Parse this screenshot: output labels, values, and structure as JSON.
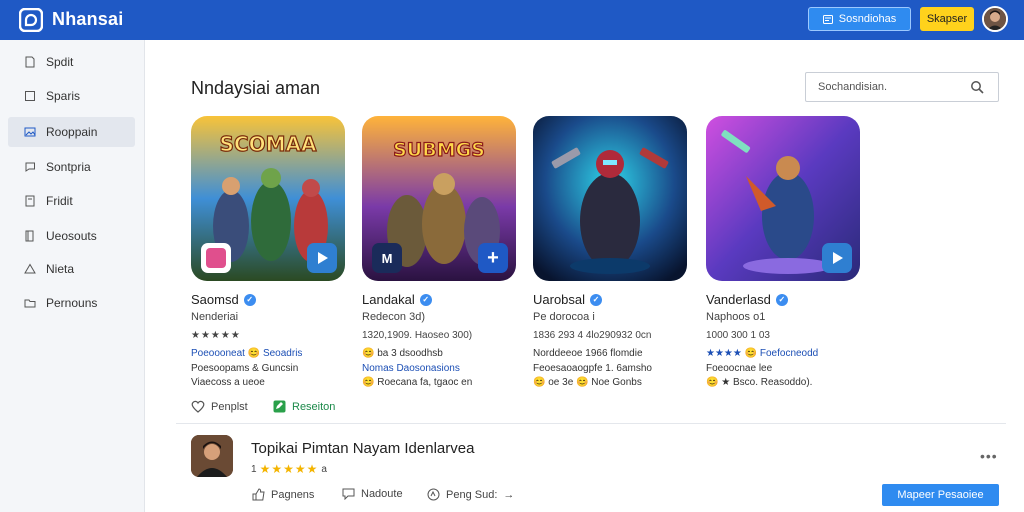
{
  "app": {
    "name": "Nhansai",
    "header_button_label": "Sosndiohas",
    "header_yellow_label": "Skapser"
  },
  "sidebar": {
    "items": [
      {
        "label": "Spdit",
        "icon": "document-icon"
      },
      {
        "label": "Sparis",
        "icon": "square-icon"
      },
      {
        "label": "Rooppain",
        "icon": "image-icon",
        "active": true
      },
      {
        "label": "Sontpria",
        "icon": "chat-icon"
      },
      {
        "label": "Fridit",
        "icon": "file-icon"
      },
      {
        "label": "Ueosouts",
        "icon": "book-icon"
      },
      {
        "label": "Nieta",
        "icon": "triangle-icon"
      },
      {
        "label": "Pernouns",
        "icon": "folder-icon"
      }
    ]
  },
  "main": {
    "title": "Nndaysiai aman",
    "search_placeholder": "Sochandisian."
  },
  "cards": [
    {
      "art_title": "SCOMAA",
      "name": "Saomsd",
      "sub": "Nenderiai",
      "meta": "★★★★★",
      "l1": "Poeoooneat 😊 Seoadris",
      "l2": "Poesoopams & Guncsin",
      "l3": "Viaecoss a ueoe",
      "colors": [
        "#f6b32b",
        "#2f7fd1"
      ],
      "badge": "#e04f8d"
    },
    {
      "art_title": "SUBMGS",
      "name": "Landakal",
      "sub": "Redecon 3d)",
      "meta": "1320,1909. Haoseo 300)",
      "l1": "😊 ba 3 dsoodhsb",
      "l2": "Nomas Daosonasions",
      "l3": "😊 Roecana fa, tgaoc en",
      "colors": [
        "#ffb33a",
        "#6b2fa0"
      ],
      "badge": "#1a2b5a"
    },
    {
      "art_title": "",
      "name": "Uarobsal",
      "sub": "Pe dorocoa i",
      "meta": "1836 293 4 4lo290932 0cn",
      "l1": "Norddeeoe 1966 flomdie",
      "l2": "Feoesaoaogpfe 1. 6amsho",
      "l3": "😊 oe 3e 😊 Noe Gonbs",
      "colors": [
        "#1fb6d6",
        "#0a1838"
      ],
      "badge": ""
    },
    {
      "art_title": "",
      "name": "Vanderlasd",
      "sub": "Naphoos o1",
      "meta": "1000 300 1 03",
      "l1": "★★★★ 😊 Foefocneodd",
      "l2": "Foeoocnae lee",
      "l3": "😊 ★ Bsco. Reasoddo).",
      "colors": [
        "#c24fe0",
        "#3a2fa8"
      ],
      "badge": "#2f7fd1"
    }
  ],
  "actions": {
    "like": "Penplst",
    "report": "Reseiton"
  },
  "feed": {
    "title": "Topikai Pimtan Nayam Idenlarvea",
    "rating_prefix": "1",
    "rating_suffix": "a",
    "actions": [
      "Pagnens",
      "Nadoute",
      "Peng Sud:"
    ],
    "button": "Mapeer Pesaoiee"
  },
  "colors": {
    "header": "#1f59c5",
    "accent": "#2f8bf0",
    "yellow": "#ffd21c",
    "star": "#f4b400"
  }
}
